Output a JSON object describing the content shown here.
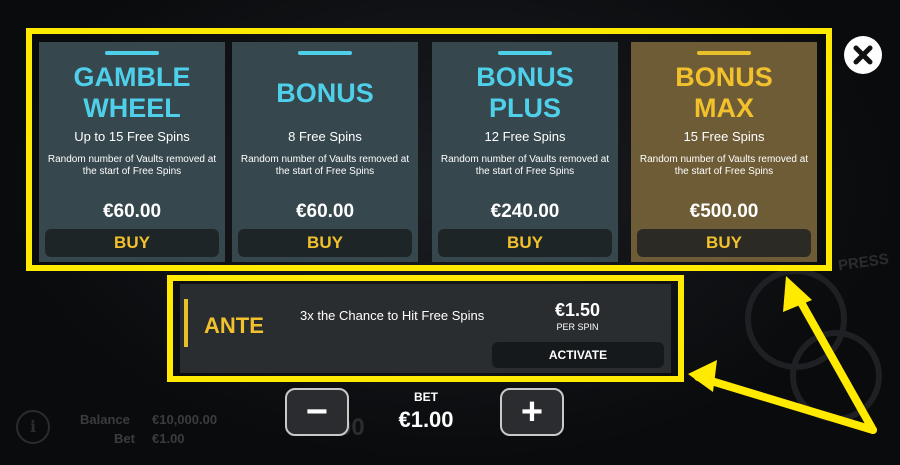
{
  "colors": {
    "highlight": "#ffea00",
    "card_bg": "#36474d",
    "card_max_bg": "#6e5c36",
    "title_cyan": "#4fd0ea",
    "title_gold": "#f2c12c",
    "buy_text": "#f2c12c"
  },
  "cards": [
    {
      "title": "GAMBLE WHEEL",
      "spins": "Up to 15 Free Spins",
      "description": "Random number of Vaults removed at the start of Free Spins",
      "price": "€60.00",
      "buy_label": "BUY"
    },
    {
      "title": "BONUS",
      "spins": "8 Free Spins",
      "description": "Random number of Vaults removed at the start of Free Spins",
      "price": "€60.00",
      "buy_label": "BUY"
    },
    {
      "title": "BONUS PLUS",
      "spins": "12 Free Spins",
      "description": "Random number of Vaults removed at the start of Free Spins",
      "price": "€240.00",
      "buy_label": "BUY"
    },
    {
      "title": "BONUS MAX",
      "spins": "15 Free Spins",
      "description": "Random number of Vaults removed at the start of Free Spins",
      "price": "€500.00",
      "buy_label": "BUY"
    }
  ],
  "ante": {
    "label": "ANTE",
    "description": "3x the Chance to Hit Free Spins",
    "price": "€1.50",
    "per_spin": "PER SPIN",
    "activate_label": "ACTIVATE"
  },
  "bet": {
    "label": "BET",
    "value": "€1.00",
    "decrease_symbol": "−",
    "increase_symbol": "+"
  },
  "status": {
    "balance_label": "Balance",
    "balance_value": "€10,000.00",
    "bet_label": "Bet",
    "bet_value": "€1.00",
    "bg_win": "00"
  },
  "icons": {
    "close": "close-icon",
    "info": "info-icon"
  },
  "background_text": {
    "press": "PRESS"
  }
}
